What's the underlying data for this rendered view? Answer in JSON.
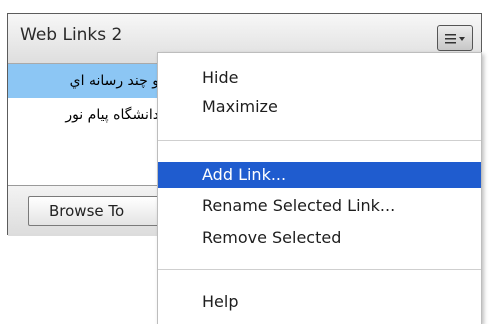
{
  "pod": {
    "title": "Web Links 2",
    "options_icon": "menu-lines-dropdown-icon",
    "links": [
      {
        "label": "و چند رسانه اي",
        "selected": true
      },
      {
        "label": "دانشگاه پيام نور",
        "selected": false
      }
    ],
    "browse_button": "Browse To"
  },
  "menu": {
    "hide": "Hide",
    "maximize": "Maximize",
    "add_link": "Add Link...",
    "rename_selected": "Rename Selected Link...",
    "remove_selected": "Remove Selected",
    "help": "Help",
    "highlighted_item": "add_link"
  },
  "colors": {
    "selection": "#8cc6f4",
    "menu_highlight": "#1f5ccf"
  }
}
